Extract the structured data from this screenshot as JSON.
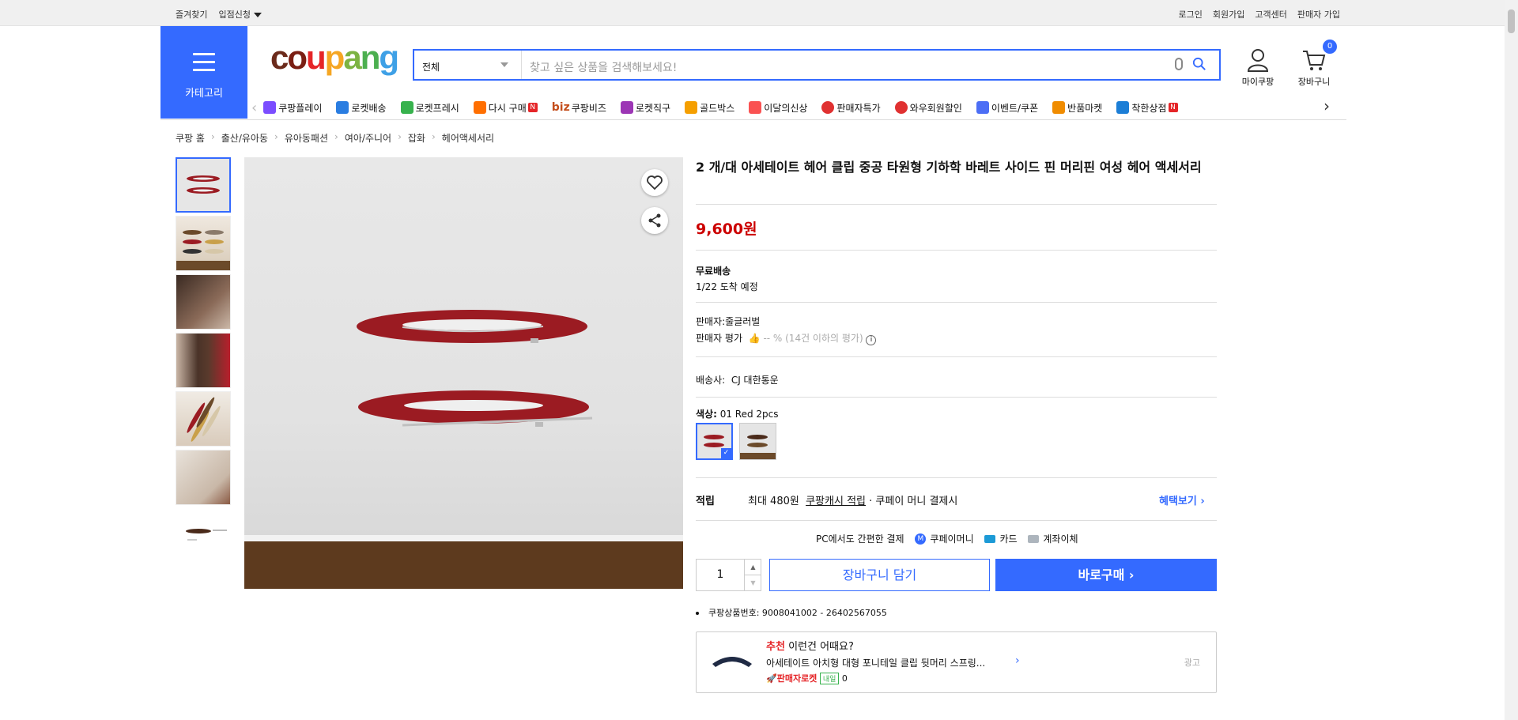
{
  "topbar": {
    "left": [
      "즐겨찾기",
      "입점신청"
    ],
    "right": [
      "로그인",
      "회원가입",
      "고객센터",
      "판매자 가입"
    ]
  },
  "category_label": "카테고리",
  "logo_text": "coupang",
  "search": {
    "category": "전체",
    "placeholder": "찾고 싶은 상품을 검색해보세요!"
  },
  "header": {
    "account_label": "마이쿠팡",
    "cart_label": "장바구니",
    "cart_count": "0"
  },
  "nav": [
    {
      "label": "쿠팡플레이",
      "color": "#7b4dff",
      "n": false
    },
    {
      "label": "로켓배송",
      "color": "#2a7de1",
      "n": false
    },
    {
      "label": "로켓프레시",
      "color": "#37b24d",
      "n": false
    },
    {
      "label": "다시 구매",
      "color": "#ff6f00",
      "n": true
    },
    {
      "label": "쿠팡비즈",
      "color": "#c44e1c",
      "n": false
    },
    {
      "label": "로켓직구",
      "color": "#9c36b5",
      "n": false
    },
    {
      "label": "골드박스",
      "color": "#f59f00",
      "n": false
    },
    {
      "label": "이달의신상",
      "color": "#fa5252",
      "n": false
    },
    {
      "label": "판매자특가",
      "color": "#e03131",
      "n": false
    },
    {
      "label": "와우회원할인",
      "color": "#e03131",
      "n": false
    },
    {
      "label": "이벤트/쿠폰",
      "color": "#4c6ef5",
      "n": false
    },
    {
      "label": "반품마켓",
      "color": "#f08c00",
      "n": false
    },
    {
      "label": "착한상점",
      "color": "#1c7ed6",
      "n": true
    }
  ],
  "nav_new_badge": "N",
  "nav_biz_prefix": "biz",
  "breadcrumb": [
    "쿠팡 홈",
    "출산/유아동",
    "유아동패션",
    "여아/주니어",
    "잡화",
    "헤어액세서리"
  ],
  "product": {
    "title": "2 개/대 아세테이트 헤어 클립 중공 타원형 기하학 바레트 사이드 핀 머리핀 여성 헤어 액세서리",
    "price": "9,600원",
    "shipping_title": "무료배송",
    "shipping_eta": "1/22 도착 예정",
    "seller_label": "판매자:",
    "seller_name": "줄글러벌",
    "rating_label": "판매자 평가",
    "rating_value": "-- % (14건 이하의 평가)",
    "carrier_label": "배송사:",
    "carrier_name": "CJ 대한통운",
    "color_label": "색상:",
    "color_value": "01 Red 2pcs",
    "reward_label": "적립",
    "reward_text1": "최대 480원",
    "reward_link": "쿠팡캐시 적립",
    "reward_text2": "· 쿠페이 머니 결제시",
    "benefit_link": "혜택보기",
    "pay_title": "PC에서도 간편한 결제",
    "pay_methods": [
      "쿠페이머니",
      "카드",
      "계좌이체"
    ],
    "quantity": "1",
    "cart_button": "장바구니 담기",
    "buy_button": "바로구매",
    "product_id": "쿠팡상품번호: 9008041002 - 26402567055"
  },
  "recommend": {
    "tag": "추천",
    "heading": "이런건 어때요?",
    "title": "아세테이트 아치형 대형 포니테일 클립 뒷머리 스프링...",
    "seller_badge": "판매자로켓",
    "delivery_badge": "내일",
    "reviews": "0",
    "ad_label": "광고"
  },
  "colors": {
    "accent": "#346aff",
    "price": "#cc0000",
    "clip_red": "#9b1b22"
  }
}
